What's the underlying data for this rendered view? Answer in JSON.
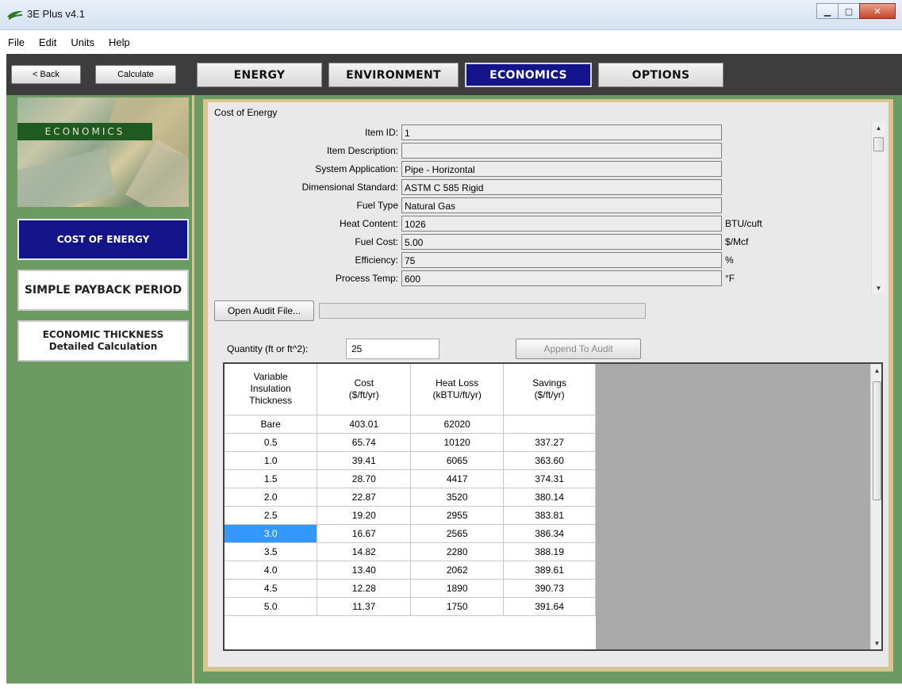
{
  "window": {
    "title": "3E Plus v4.1",
    "icon": "app-logo-icon"
  },
  "menu": [
    "File",
    "Edit",
    "Units",
    "Help"
  ],
  "toolbar": {
    "back_label": "< Back",
    "calculate_label": "Calculate"
  },
  "tabs": [
    {
      "label": "ENERGY",
      "active": false
    },
    {
      "label": "ENVIRONMENT",
      "active": false
    },
    {
      "label": "ECONOMICS",
      "active": true
    },
    {
      "label": "OPTIONS",
      "active": false
    }
  ],
  "sidebar": {
    "hero_label": "ECONOMICS",
    "items": [
      {
        "label": "COST OF ENERGY",
        "active": true
      },
      {
        "label": "SIMPLE PAYBACK PERIOD",
        "active": false
      },
      {
        "label": "ECONOMIC THICKNESS",
        "label2": "Detailed Calculation",
        "active": false
      }
    ]
  },
  "cost_of_energy": {
    "group_title": "Cost of Energy",
    "fields": [
      {
        "label": "Item ID:",
        "value": "1",
        "unit": ""
      },
      {
        "label": "Item Description:",
        "value": "",
        "unit": ""
      },
      {
        "label": "System Application:",
        "value": "Pipe - Horizontal",
        "unit": ""
      },
      {
        "label": "Dimensional Standard:",
        "value": "ASTM C 585 Rigid",
        "unit": ""
      },
      {
        "label": "Fuel Type",
        "value": "Natural Gas",
        "unit": ""
      },
      {
        "label": "Heat Content:",
        "value": "1026",
        "unit": "BTU/cuft"
      },
      {
        "label": "Fuel Cost:",
        "value": "5.00",
        "unit": "$/Mcf"
      },
      {
        "label": "Efficiency:",
        "value": "75",
        "unit": "%"
      },
      {
        "label": "Process Temp:",
        "value": "600",
        "unit": "°F"
      }
    ]
  },
  "audit": {
    "open_label": "Open Audit File...",
    "path": "",
    "quantity_label": "Quantity (ft or ft^2):",
    "quantity_value": "25",
    "append_label": "Append To Audit"
  },
  "results": {
    "headers": [
      "Variable Insulation Thickness",
      "Cost ($/ft/yr)",
      "Heat Loss (kBTU/ft/yr)",
      "Savings ($/ft/yr)"
    ],
    "rows": [
      [
        "Bare",
        "403.01",
        "62020",
        ""
      ],
      [
        "0.5",
        "65.74",
        "10120",
        "337.27"
      ],
      [
        "1.0",
        "39.41",
        "6065",
        "363.60"
      ],
      [
        "1.5",
        "28.70",
        "4417",
        "374.31"
      ],
      [
        "2.0",
        "22.87",
        "3520",
        "380.14"
      ],
      [
        "2.5",
        "19.20",
        "2955",
        "383.81"
      ],
      [
        "3.0",
        "16.67",
        "2565",
        "386.34"
      ],
      [
        "3.5",
        "14.82",
        "2280",
        "388.19"
      ],
      [
        "4.0",
        "13.40",
        "2062",
        "389.61"
      ],
      [
        "4.5",
        "12.28",
        "1890",
        "390.73"
      ],
      [
        "5.0",
        "11.37",
        "1750",
        "391.64"
      ]
    ],
    "selected_row": 6
  }
}
